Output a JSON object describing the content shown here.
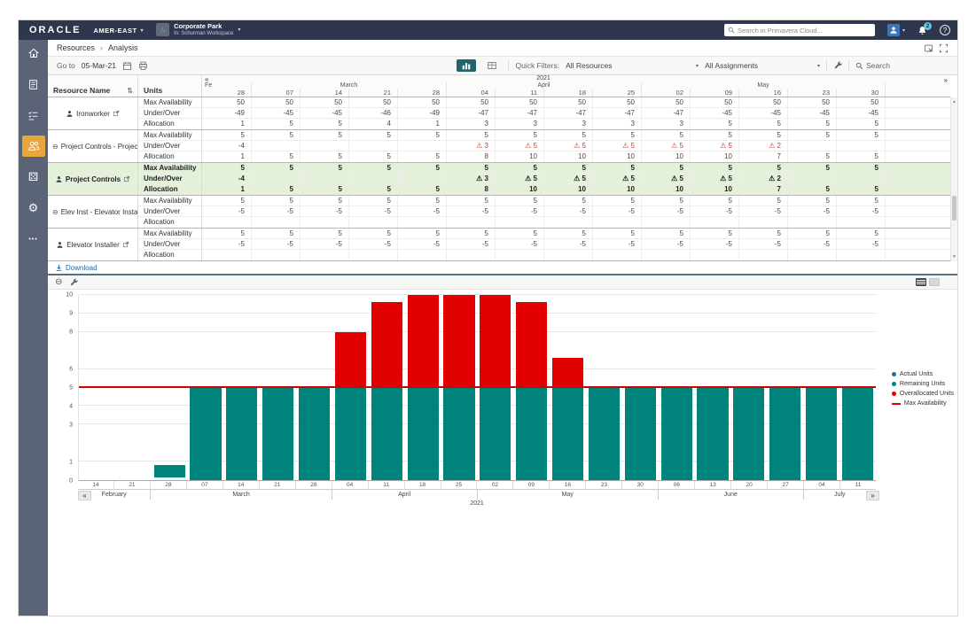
{
  "colors": {
    "navbar": "#2F374E",
    "sidebar": "#5B6377",
    "sidebar-active": "#ECA53C",
    "accent-teal": "#24646D",
    "selected-row": "#E4F0DA",
    "warn": "#C0402F",
    "link": "#0B6BBD",
    "badge": "#67C8DC"
  },
  "icons": {
    "caret-down": "▾",
    "breadcrumb-separator": "›",
    "sort": "⇅",
    "collapse": "⊖",
    "warning": "⚠",
    "more": "•••",
    "dice": "⚄",
    "gear": "⚙",
    "help": "?",
    "scroll-up": "▲",
    "scroll-down": "▼"
  },
  "topbar": {
    "brand": "ORACLE",
    "org_label": "AMER-EAST",
    "workspace_title": "Corporate Park",
    "workspace_subtitle": "In: Schurman Workspace",
    "search_placeholder": "Search in Primavera Cloud...",
    "notification_count": "2"
  },
  "breadcrumb": {
    "items": [
      "Resources",
      "Analysis"
    ]
  },
  "toolbar": {
    "goto_label": "Go to",
    "goto_date": "05-Mar-21",
    "quick_filters_label": "Quick Filters:",
    "resources_filter_value": "All Resources",
    "assignments_filter_value": "All Assignments",
    "search_label": "Search"
  },
  "table": {
    "resource_col_header": "Resource Name",
    "units_col_header": "Units",
    "year_label": "2021",
    "prev_arrow": "«",
    "next_arrow": "»",
    "first_month_truncated": "Fe",
    "unit_row_labels": [
      "Max Availability",
      "Under/Over",
      "Allocation"
    ],
    "month_groups": [
      {
        "label": "",
        "span": 1
      },
      {
        "label": "March",
        "span": 4
      },
      {
        "label": "April",
        "span": 4
      },
      {
        "label": "May",
        "span": 5
      }
    ],
    "date_cols": [
      "28",
      "07",
      "14",
      "21",
      "28",
      "04",
      "11",
      "18",
      "25",
      "02",
      "09",
      "16",
      "23",
      "30"
    ],
    "resources": [
      {
        "name": "Ironworker",
        "kind": "resource",
        "selected": false,
        "max_availability": [
          "50",
          "50",
          "50",
          "50",
          "50",
          "50",
          "50",
          "50",
          "50",
          "50",
          "50",
          "50",
          "50",
          "50"
        ],
        "under_over": [
          "-49",
          "-45",
          "-45",
          "-46",
          "-49",
          "-47",
          "-47",
          "-47",
          "-47",
          "-47",
          "-45",
          "-45",
          "-45",
          "-45"
        ],
        "allocation": [
          "1",
          "5",
          "5",
          "4",
          "1",
          "3",
          "3",
          "3",
          "3",
          "3",
          "5",
          "5",
          "5",
          "5"
        ]
      },
      {
        "name": "Project Controls - Project Co...",
        "kind": "group",
        "selected": false,
        "max_availability": [
          "5",
          "5",
          "5",
          "5",
          "5",
          "5",
          "5",
          "5",
          "5",
          "5",
          "5",
          "5",
          "5",
          "5"
        ],
        "under_over": [
          "-4",
          "",
          "",
          "",
          "",
          "!3",
          "!5",
          "!5",
          "!5",
          "!5",
          "!5",
          "!2",
          "",
          ""
        ],
        "allocation": [
          "1",
          "5",
          "5",
          "5",
          "5",
          "8",
          "10",
          "10",
          "10",
          "10",
          "10",
          "7",
          "5",
          "5"
        ]
      },
      {
        "name": "Project Controls",
        "kind": "resource",
        "selected": true,
        "max_availability": [
          "5",
          "5",
          "5",
          "5",
          "5",
          "5",
          "5",
          "5",
          "5",
          "5",
          "5",
          "5",
          "5",
          "5"
        ],
        "under_over": [
          "-4",
          "",
          "",
          "",
          "",
          "!3",
          "!5",
          "!5",
          "!5",
          "!5",
          "!5",
          "!2",
          "",
          ""
        ],
        "allocation": [
          "1",
          "5",
          "5",
          "5",
          "5",
          "8",
          "10",
          "10",
          "10",
          "10",
          "10",
          "7",
          "5",
          "5"
        ]
      },
      {
        "name": "Elev Inst - Elevator Installer",
        "kind": "group",
        "selected": false,
        "max_availability": [
          "5",
          "5",
          "5",
          "5",
          "5",
          "5",
          "5",
          "5",
          "5",
          "5",
          "5",
          "5",
          "5",
          "5"
        ],
        "under_over": [
          "-5",
          "-5",
          "-5",
          "-5",
          "-5",
          "-5",
          "-5",
          "-5",
          "-5",
          "-5",
          "-5",
          "-5",
          "-5",
          "-5"
        ],
        "allocation": [
          "",
          "",
          "",
          "",
          "",
          "",
          "",
          "",
          "",
          "",
          "",
          "",
          "",
          ""
        ]
      },
      {
        "name": "Elevator Installer",
        "kind": "resource",
        "selected": false,
        "max_availability": [
          "5",
          "5",
          "5",
          "5",
          "5",
          "5",
          "5",
          "5",
          "5",
          "5",
          "5",
          "5",
          "5",
          "5"
        ],
        "under_over": [
          "-5",
          "-5",
          "-5",
          "-5",
          "-5",
          "-5",
          "-5",
          "-5",
          "-5",
          "-5",
          "-5",
          "-5",
          "-5",
          "-5"
        ],
        "allocation": [
          "",
          "",
          "",
          "",
          "",
          "",
          "",
          "",
          "",
          "",
          "",
          "",
          "",
          ""
        ]
      }
    ]
  },
  "download": {
    "label": "Download"
  },
  "chart_data": {
    "type": "bar",
    "stacked": true,
    "title": "",
    "xlabel": "",
    "ylabel": "",
    "ylim": [
      0,
      10
    ],
    "grid": true,
    "legend_position": "right",
    "year_label": "2021",
    "prev_arrow": "«",
    "next_arrow": "»",
    "x": [
      "14",
      "21",
      "28",
      "07",
      "14",
      "21",
      "28",
      "04",
      "11",
      "18",
      "25",
      "02",
      "09",
      "16",
      "23",
      "30",
      "06",
      "13",
      "20",
      "27",
      "04",
      "11"
    ],
    "month_groups": [
      {
        "label": "February",
        "span": 2
      },
      {
        "label": "March",
        "span": 5
      },
      {
        "label": "April",
        "span": 4
      },
      {
        "label": "May",
        "span": 5
      },
      {
        "label": "June",
        "span": 4
      },
      {
        "label": "July",
        "span": 2
      }
    ],
    "totals": [
      0,
      0,
      0.8,
      5,
      5,
      5,
      5,
      8,
      9.6,
      10,
      10,
      10,
      9.6,
      6.6,
      5,
      5,
      5,
      5,
      5,
      5,
      5,
      5
    ],
    "series": [
      {
        "name": "Remaining Units",
        "color": "#00837B"
      },
      {
        "name": "Overallocated Units",
        "color": "#E00000"
      }
    ],
    "max_availability_line": 5,
    "max_line_color": "#D40000",
    "y_ticks": [
      0,
      1,
      3,
      4,
      5,
      6,
      8,
      9,
      10
    ],
    "legend": [
      {
        "label": "Actual Units",
        "color": "#1F6FA8",
        "marker": "dot"
      },
      {
        "label": "Remaining Units",
        "color": "#00837B",
        "marker": "dot"
      },
      {
        "label": "Overallocated Units",
        "color": "#E00000",
        "marker": "dot"
      },
      {
        "label": "Max Availability",
        "color": "#E00000",
        "marker": "line"
      }
    ]
  }
}
